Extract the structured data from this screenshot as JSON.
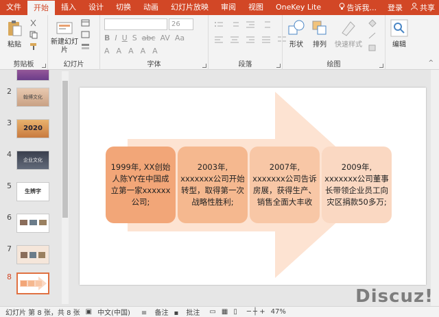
{
  "tabs": [
    "文件",
    "开始",
    "插入",
    "设计",
    "切换",
    "动画",
    "幻灯片放映",
    "审阅",
    "视图",
    "OneKey Lite"
  ],
  "active_tab_index": 1,
  "tell_me": "告诉我...",
  "login": "登录",
  "share": "共享",
  "ribbon": {
    "clipboard": {
      "paste": "粘贴",
      "label": "剪贴板"
    },
    "slides": {
      "new_slide": "新建幻灯片",
      "label": "幻灯片"
    },
    "font": {
      "size": "26",
      "label": "字体"
    },
    "paragraph": {
      "label": "段落"
    },
    "drawing": {
      "shapes": "形状",
      "arrange": "排列",
      "quick_styles": "快速样式",
      "label": "绘图"
    },
    "editing": {
      "edit": "编辑"
    }
  },
  "thumbnails": [
    {
      "num": "",
      "text": ""
    },
    {
      "num": "2",
      "text": "翰博文化"
    },
    {
      "num": "3",
      "text": "2020"
    },
    {
      "num": "4",
      "text": "企业文化"
    },
    {
      "num": "5",
      "text": "生辨字"
    },
    {
      "num": "6",
      "text": ""
    },
    {
      "num": "7",
      "text": ""
    },
    {
      "num": "8",
      "text": ""
    }
  ],
  "slide": {
    "boxes": [
      {
        "text": "1999年, XX创始人陈YY在中国成立第一家xxxxxx公司;",
        "color": "#f2a678"
      },
      {
        "text": "2003年, xxxxxxx公司开始转型，取得第一次战略性胜利;",
        "color": "#f5b88f"
      },
      {
        "text": "2007年, xxxxxxx公司告诉房展，获得生产、销售全面大丰收",
        "color": "#f8c7a6"
      },
      {
        "text": "2009年, xxxxxxx公司董事长带领企业员工向灾区捐款50多万;",
        "color": "#fad8c2"
      }
    ],
    "arrow_color": "#fde3d2"
  },
  "status": {
    "slide_info": "幻灯片 第 8 张，共 8 张",
    "language": "中文(中国)",
    "notes": "备注",
    "comments": "批注",
    "zoom": "47%"
  },
  "watermark": "Discuz!"
}
